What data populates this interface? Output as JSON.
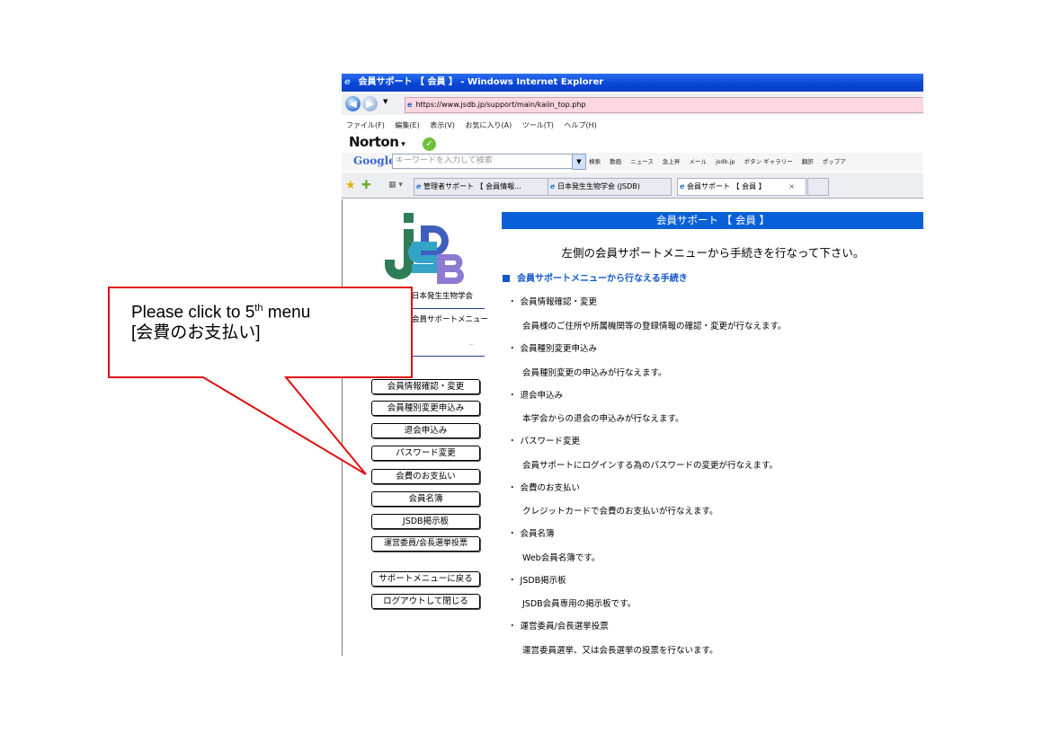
{
  "window": {
    "title": "会員サポート 【 会員 】 - Windows Internet Explorer",
    "url": "https://www.jsdb.jp/support/main/kaiin_top.php"
  },
  "menubar": [
    "ファイル(F)",
    "編集(E)",
    "表示(V)",
    "お気に入り(A)",
    "ツール(T)",
    "ヘルプ(H)"
  ],
  "norton": {
    "label": "Norton"
  },
  "google_toolbar": {
    "logo": "Google",
    "search_placeholder": "キーワードを入力して検索",
    "items": [
      "検索",
      "動画",
      "ニュース",
      "急上昇",
      "メール",
      "jsdb.jp",
      "ボタン ギャラリー",
      "翻訳",
      "ポップア"
    ]
  },
  "tabs": [
    {
      "label": "管理者サポート 【 会員情報..."
    },
    {
      "label": "日本発生生物学会 (JSDB)"
    },
    {
      "label": "会員サポート 【 会員 】"
    }
  ],
  "sidebar": {
    "logo_text": "JSDB",
    "society_name": "日本発生生物学会",
    "menu_title": "会員サポートメニュー",
    "user_name": "...",
    "buttons": [
      "会員情報確認・変更",
      "会員種別変更申込み",
      "退会申込み",
      "パスワード変更",
      "会費のお支払い",
      "会員名簿",
      "JSDB掲示板",
      "運営委員/会長選挙投票"
    ],
    "back_button": "サポートメニューに戻る",
    "logout_button": "ログアウトして閉じる"
  },
  "main": {
    "header": "会員サポート 【 会員 】",
    "instruction": "左側の会員サポートメニューから手続きを行なって下さい。",
    "section_title": "会員サポートメニューから行なえる手続き",
    "items": [
      {
        "title": "会員情報確認・変更",
        "desc": "会員様のご住所や所属機関等の登録情報の確認・変更が行なえます。"
      },
      {
        "title": "会員種別変更申込み",
        "desc": "会員種別変更の申込みが行なえます。"
      },
      {
        "title": "退会申込み",
        "desc": "本学会からの退会の申込みが行なえます。"
      },
      {
        "title": "パスワード変更",
        "desc": "会員サポートにログインする為のパスワードの変更が行なえます。"
      },
      {
        "title": "会費のお支払い",
        "desc": "クレジットカードで会費のお支払いが行なえます。"
      },
      {
        "title": "会員名簿",
        "desc": "Web会員名簿です。"
      },
      {
        "title": "JSDB掲示板",
        "desc": "JSDB会員専用の掲示板です。"
      },
      {
        "title": "運営委員/会長選挙投票",
        "desc": "運営委員選挙、又は会長選挙の投票を行ないます。"
      }
    ]
  },
  "callout": {
    "line1_a": "Please click to 5",
    "line1_sup": "th",
    "line1_b": " menu",
    "line2": "[会費のお支払い]",
    "border_color": "#e01010"
  }
}
